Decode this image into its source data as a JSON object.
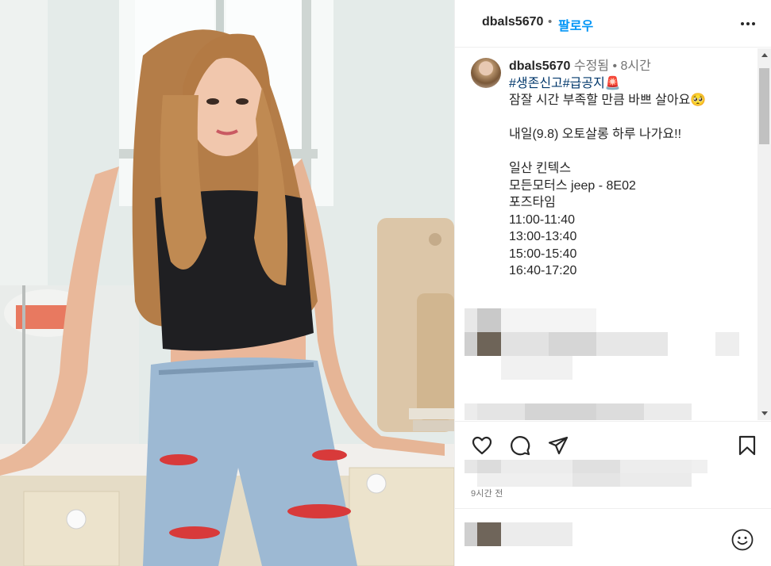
{
  "header": {
    "username": "dbals5670",
    "separator": "•",
    "follow_label": "팔로우",
    "more_icon": "more-horizontal-icon"
  },
  "caption": {
    "username": "dbals5670",
    "edited_label": "수정됨",
    "separator": "•",
    "age": "8시간",
    "hashtags": "#생존신고#급공지",
    "hashtag_emoji": "🚨",
    "line1": "잠잘 시간 부족할 만큼 바쁘 살아요",
    "line1_emoji": "🥺",
    "line2": "내일(9.8) 오토살롱 하루 나가요!!",
    "line3": "일산 킨텍스",
    "line4": "모든모터스 jeep - 8E02",
    "line5": "포즈타임",
    "times": [
      "11:00-11:40",
      "13:00-13:40",
      "15:00-15:40",
      "16:40-17:20"
    ]
  },
  "actions": {
    "like_icon": "heart-icon",
    "comment_icon": "comment-icon",
    "share_icon": "send-icon",
    "save_icon": "bookmark-icon"
  },
  "timestamp": "9시간 전",
  "comment": {
    "emoji_icon": "smiley-icon"
  },
  "colors": {
    "link": "#0095f6",
    "hashtag": "#00376b",
    "muted": "#737373",
    "border": "#efefef"
  }
}
